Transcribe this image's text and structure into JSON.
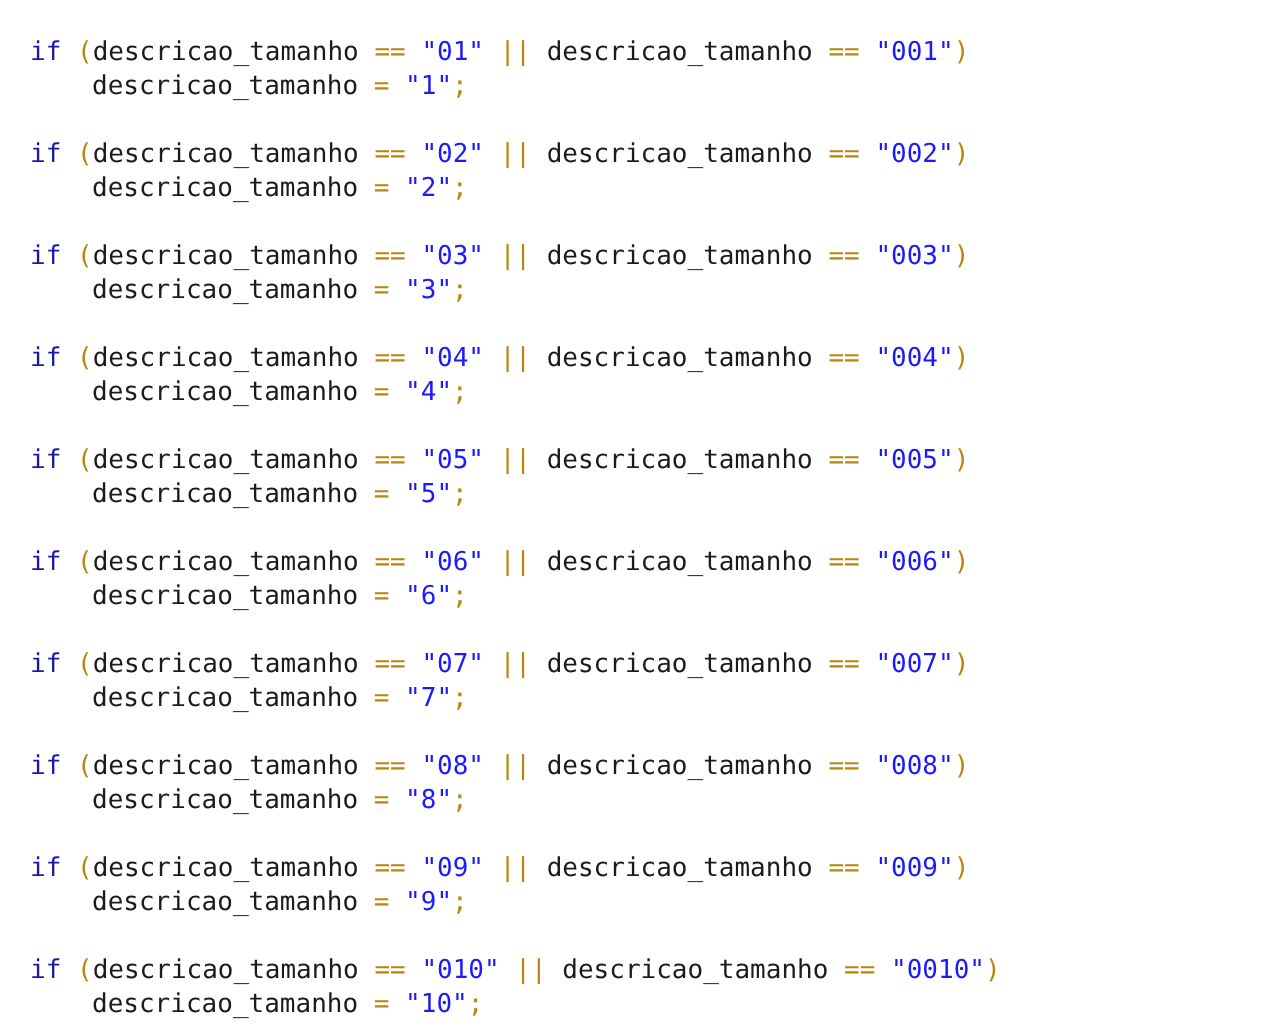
{
  "code_blocks": [
    {
      "condition": [
        {
          "kind": "keyword",
          "text": "if "
        },
        {
          "kind": "punct",
          "text": "("
        },
        {
          "kind": "ident",
          "text": "descricao_tamanho "
        },
        {
          "kind": "punct",
          "text": "== "
        },
        {
          "kind": "string",
          "text": "\"01\""
        },
        {
          "kind": "punct",
          "text": " || "
        },
        {
          "kind": "ident",
          "text": "descricao_tamanho "
        },
        {
          "kind": "punct",
          "text": "== "
        },
        {
          "kind": "string",
          "text": "\"001\""
        },
        {
          "kind": "punct",
          "text": ")"
        }
      ],
      "body": [
        {
          "kind": "ident",
          "text": "descricao_tamanho "
        },
        {
          "kind": "punct",
          "text": "= "
        },
        {
          "kind": "string",
          "text": "\"1\""
        },
        {
          "kind": "punct",
          "text": ";"
        }
      ]
    },
    {
      "condition": [
        {
          "kind": "keyword",
          "text": "if "
        },
        {
          "kind": "punct",
          "text": "("
        },
        {
          "kind": "ident",
          "text": "descricao_tamanho "
        },
        {
          "kind": "punct",
          "text": "== "
        },
        {
          "kind": "string",
          "text": "\"02\""
        },
        {
          "kind": "punct",
          "text": " || "
        },
        {
          "kind": "ident",
          "text": "descricao_tamanho "
        },
        {
          "kind": "punct",
          "text": "== "
        },
        {
          "kind": "string",
          "text": "\"002\""
        },
        {
          "kind": "punct",
          "text": ")"
        }
      ],
      "body": [
        {
          "kind": "ident",
          "text": "descricao_tamanho "
        },
        {
          "kind": "punct",
          "text": "= "
        },
        {
          "kind": "string",
          "text": "\"2\""
        },
        {
          "kind": "punct",
          "text": ";"
        }
      ]
    },
    {
      "condition": [
        {
          "kind": "keyword",
          "text": "if "
        },
        {
          "kind": "punct",
          "text": "("
        },
        {
          "kind": "ident",
          "text": "descricao_tamanho "
        },
        {
          "kind": "punct",
          "text": "== "
        },
        {
          "kind": "string",
          "text": "\"03\""
        },
        {
          "kind": "punct",
          "text": " || "
        },
        {
          "kind": "ident",
          "text": "descricao_tamanho "
        },
        {
          "kind": "punct",
          "text": "== "
        },
        {
          "kind": "string",
          "text": "\"003\""
        },
        {
          "kind": "punct",
          "text": ")"
        }
      ],
      "body": [
        {
          "kind": "ident",
          "text": "descricao_tamanho "
        },
        {
          "kind": "punct",
          "text": "= "
        },
        {
          "kind": "string",
          "text": "\"3\""
        },
        {
          "kind": "punct",
          "text": ";"
        }
      ]
    },
    {
      "condition": [
        {
          "kind": "keyword",
          "text": "if "
        },
        {
          "kind": "punct",
          "text": "("
        },
        {
          "kind": "ident",
          "text": "descricao_tamanho "
        },
        {
          "kind": "punct",
          "text": "== "
        },
        {
          "kind": "string",
          "text": "\"04\""
        },
        {
          "kind": "punct",
          "text": " || "
        },
        {
          "kind": "ident",
          "text": "descricao_tamanho "
        },
        {
          "kind": "punct",
          "text": "== "
        },
        {
          "kind": "string",
          "text": "\"004\""
        },
        {
          "kind": "punct",
          "text": ")"
        }
      ],
      "body": [
        {
          "kind": "ident",
          "text": "descricao_tamanho "
        },
        {
          "kind": "punct",
          "text": "= "
        },
        {
          "kind": "string",
          "text": "\"4\""
        },
        {
          "kind": "punct",
          "text": ";"
        }
      ]
    },
    {
      "condition": [
        {
          "kind": "keyword",
          "text": "if "
        },
        {
          "kind": "punct",
          "text": "("
        },
        {
          "kind": "ident",
          "text": "descricao_tamanho "
        },
        {
          "kind": "punct",
          "text": "== "
        },
        {
          "kind": "string",
          "text": "\"05\""
        },
        {
          "kind": "punct",
          "text": " || "
        },
        {
          "kind": "ident",
          "text": "descricao_tamanho "
        },
        {
          "kind": "punct",
          "text": "== "
        },
        {
          "kind": "string",
          "text": "\"005\""
        },
        {
          "kind": "punct",
          "text": ")"
        }
      ],
      "body": [
        {
          "kind": "ident",
          "text": "descricao_tamanho "
        },
        {
          "kind": "punct",
          "text": "= "
        },
        {
          "kind": "string",
          "text": "\"5\""
        },
        {
          "kind": "punct",
          "text": ";"
        }
      ]
    },
    {
      "condition": [
        {
          "kind": "keyword",
          "text": "if "
        },
        {
          "kind": "punct",
          "text": "("
        },
        {
          "kind": "ident",
          "text": "descricao_tamanho "
        },
        {
          "kind": "punct",
          "text": "== "
        },
        {
          "kind": "string",
          "text": "\"06\""
        },
        {
          "kind": "punct",
          "text": " || "
        },
        {
          "kind": "ident",
          "text": "descricao_tamanho "
        },
        {
          "kind": "punct",
          "text": "== "
        },
        {
          "kind": "string",
          "text": "\"006\""
        },
        {
          "kind": "punct",
          "text": ")"
        }
      ],
      "body": [
        {
          "kind": "ident",
          "text": "descricao_tamanho "
        },
        {
          "kind": "punct",
          "text": "= "
        },
        {
          "kind": "string",
          "text": "\"6\""
        },
        {
          "kind": "punct",
          "text": ";"
        }
      ]
    },
    {
      "condition": [
        {
          "kind": "keyword",
          "text": "if "
        },
        {
          "kind": "punct",
          "text": "("
        },
        {
          "kind": "ident",
          "text": "descricao_tamanho "
        },
        {
          "kind": "punct",
          "text": "== "
        },
        {
          "kind": "string",
          "text": "\"07\""
        },
        {
          "kind": "punct",
          "text": " || "
        },
        {
          "kind": "ident",
          "text": "descricao_tamanho "
        },
        {
          "kind": "punct",
          "text": "== "
        },
        {
          "kind": "string",
          "text": "\"007\""
        },
        {
          "kind": "punct",
          "text": ")"
        }
      ],
      "body": [
        {
          "kind": "ident",
          "text": "descricao_tamanho "
        },
        {
          "kind": "punct",
          "text": "= "
        },
        {
          "kind": "string",
          "text": "\"7\""
        },
        {
          "kind": "punct",
          "text": ";"
        }
      ]
    },
    {
      "condition": [
        {
          "kind": "keyword",
          "text": "if "
        },
        {
          "kind": "punct",
          "text": "("
        },
        {
          "kind": "ident",
          "text": "descricao_tamanho "
        },
        {
          "kind": "punct",
          "text": "== "
        },
        {
          "kind": "string",
          "text": "\"08\""
        },
        {
          "kind": "punct",
          "text": " || "
        },
        {
          "kind": "ident",
          "text": "descricao_tamanho "
        },
        {
          "kind": "punct",
          "text": "== "
        },
        {
          "kind": "string",
          "text": "\"008\""
        },
        {
          "kind": "punct",
          "text": ")"
        }
      ],
      "body": [
        {
          "kind": "ident",
          "text": "descricao_tamanho "
        },
        {
          "kind": "punct",
          "text": "= "
        },
        {
          "kind": "string",
          "text": "\"8\""
        },
        {
          "kind": "punct",
          "text": ";"
        }
      ]
    },
    {
      "condition": [
        {
          "kind": "keyword",
          "text": "if "
        },
        {
          "kind": "punct",
          "text": "("
        },
        {
          "kind": "ident",
          "text": "descricao_tamanho "
        },
        {
          "kind": "punct",
          "text": "== "
        },
        {
          "kind": "string",
          "text": "\"09\""
        },
        {
          "kind": "punct",
          "text": " || "
        },
        {
          "kind": "ident",
          "text": "descricao_tamanho "
        },
        {
          "kind": "punct",
          "text": "== "
        },
        {
          "kind": "string",
          "text": "\"009\""
        },
        {
          "kind": "punct",
          "text": ")"
        }
      ],
      "body": [
        {
          "kind": "ident",
          "text": "descricao_tamanho "
        },
        {
          "kind": "punct",
          "text": "= "
        },
        {
          "kind": "string",
          "text": "\"9\""
        },
        {
          "kind": "punct",
          "text": ";"
        }
      ]
    },
    {
      "condition": [
        {
          "kind": "keyword",
          "text": "if "
        },
        {
          "kind": "punct",
          "text": "("
        },
        {
          "kind": "ident",
          "text": "descricao_tamanho "
        },
        {
          "kind": "punct",
          "text": "== "
        },
        {
          "kind": "string",
          "text": "\"010\""
        },
        {
          "kind": "punct",
          "text": " || "
        },
        {
          "kind": "ident",
          "text": "descricao_tamanho "
        },
        {
          "kind": "punct",
          "text": "== "
        },
        {
          "kind": "string",
          "text": "\"0010\""
        },
        {
          "kind": "punct",
          "text": ")"
        }
      ],
      "body": [
        {
          "kind": "ident",
          "text": "descricao_tamanho "
        },
        {
          "kind": "punct",
          "text": "= "
        },
        {
          "kind": "string",
          "text": "\"10\""
        },
        {
          "kind": "punct",
          "text": ";"
        }
      ]
    }
  ]
}
